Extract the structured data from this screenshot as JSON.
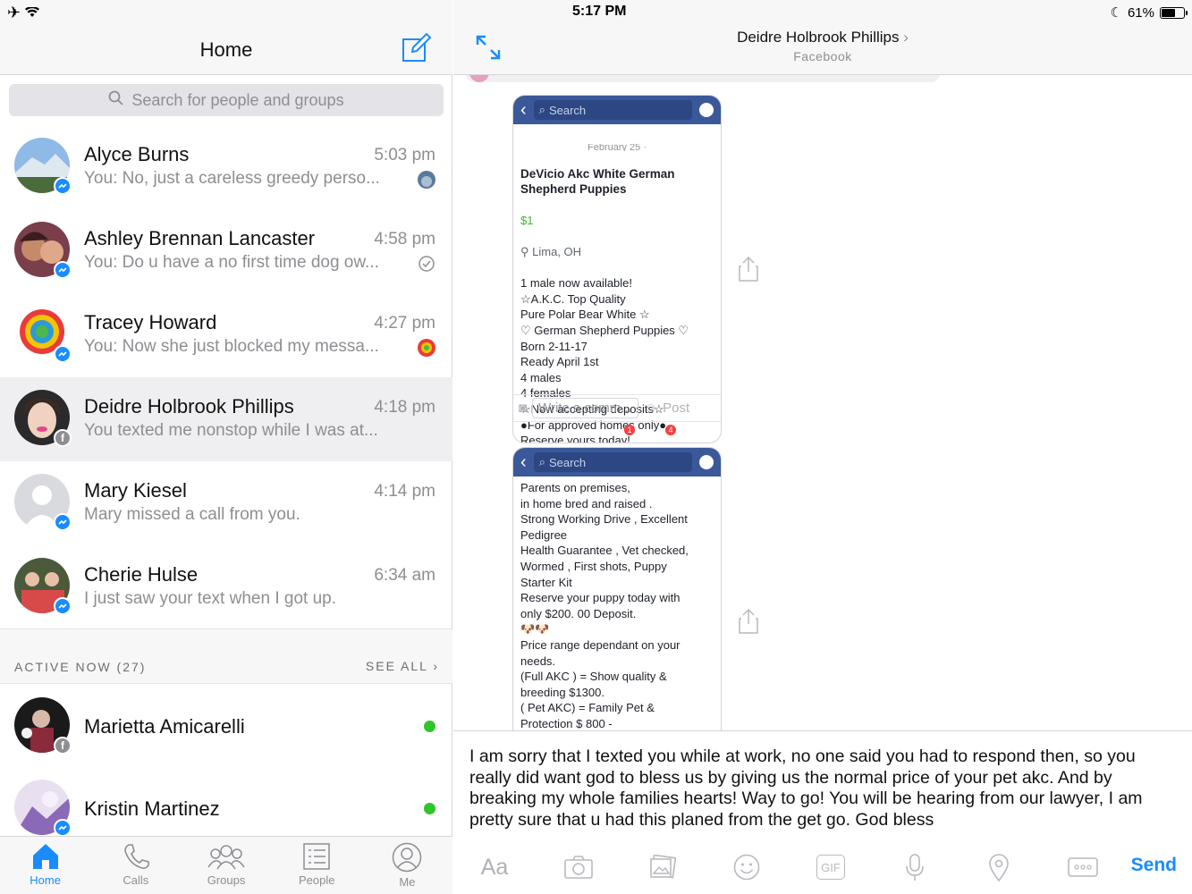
{
  "status_bar": {
    "time": "5:17 PM",
    "battery": "61%",
    "battery_level": 0.61
  },
  "left": {
    "title": "Home",
    "search_placeholder": "Search for people and groups",
    "conversations": [
      {
        "name": "Alyce Burns",
        "time": "5:03 pm",
        "preview": "You: No, just a careless greedy perso...",
        "badge": "messenger",
        "status": "seen-avatar"
      },
      {
        "name": "Ashley Brennan Lancaster",
        "time": "4:58 pm",
        "preview": "You: Do u have a no first time dog ow...",
        "badge": "messenger",
        "status": "delivered"
      },
      {
        "name": "Tracey Howard",
        "time": "4:27 pm",
        "preview": "You: Now she just blocked my messa...",
        "badge": "messenger",
        "status": "seen-avatar"
      },
      {
        "name": "Deidre Holbrook Phillips",
        "time": "4:18 pm",
        "preview": "You texted me nonstop while I was at...",
        "badge": "facebook",
        "status": "none"
      },
      {
        "name": "Mary Kiesel",
        "time": "4:14 pm",
        "preview": "Mary missed a call from you.",
        "badge": "messenger",
        "status": "none"
      },
      {
        "name": "Cherie Hulse",
        "time": "6:34 am",
        "preview": "I just saw your text when I got up.",
        "badge": "messenger",
        "status": "none"
      }
    ],
    "active_now_label": "ACTIVE NOW (27)",
    "see_all": "SEE ALL",
    "active": [
      {
        "name": "Marietta Amicarelli",
        "badge": "facebook"
      },
      {
        "name": "Kristin Martinez",
        "badge": "messenger"
      }
    ],
    "tabs": [
      {
        "label": "Home",
        "icon": "home-icon",
        "active": true
      },
      {
        "label": "Calls",
        "icon": "phone-icon",
        "active": false
      },
      {
        "label": "Groups",
        "icon": "groups-icon",
        "active": false
      },
      {
        "label": "People",
        "icon": "people-list-icon",
        "active": false
      },
      {
        "label": "Me",
        "icon": "profile-icon",
        "active": false
      }
    ]
  },
  "right": {
    "contact_name": "Deidre Holbrook Phillips",
    "contact_source": "Facebook",
    "shot1": {
      "search": "Search",
      "date": "February 25 ·",
      "title": "DeVicio Akc White German Shepherd Puppies",
      "price": "$1",
      "location": "Lima, OH",
      "body": "1 male now available!\n☆A.K.C. Top Quality\nPure Polar Bear White ☆\n♡ German Shepherd Puppies ♡\nBorn 2-11-17\nReady April 1st\n4 males\n4 females\n☆Now accepting deposits☆\n●For approved homes only●\n     Reserve yours today!\n     Parents on premises,",
      "comment_placeholder": "Write a comm...",
      "post": "Post",
      "notif1": "1",
      "notif2": "4"
    },
    "shot2": {
      "search": "Search",
      "body": "     Parents on premises,\n in home bred and  raised .\nStrong Working Drive , Excellent\nPedigree\nHealth Guarantee ,  Vet checked,\nWormed , First shots, Puppy\nStarter Kit\nReserve your puppy today with\nonly $200. 00 Deposit.\n🐶🐶\nPrice range dependant on your\nneeds.\n(Full AKC ) = Show quality &\nbreeding  $1300.\n( Pet AKC)  = Family Pet &\nProtection $ 800 -"
    },
    "draft_message": "I am sorry that I texted you while at work, no one said you had to respond then, so you really did want god to bless us by giving us the normal price of your pet akc. And by breaking my whole families hearts! Way to go! You will be hearing from our lawyer, I am pretty sure that u had this planed from the get go. God bless",
    "toolbar": {
      "aa": "Aa",
      "gif": "GIF",
      "send": "Send"
    }
  },
  "colors": {
    "accent": "#1a8cff",
    "facebook_blue": "#3b5998",
    "online": "#31c52b",
    "selected_row": "#efeff1"
  }
}
